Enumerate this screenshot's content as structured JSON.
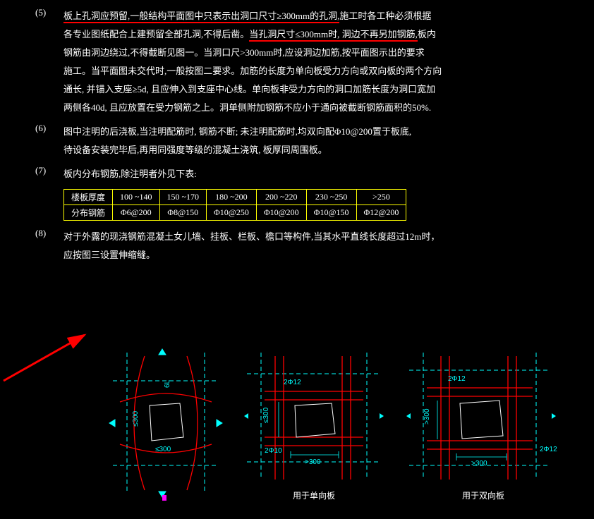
{
  "items": {
    "i5": {
      "num": "(5)",
      "t1a": "板上孔洞应预留,",
      "t1b": "一般结构平面图中只表示出洞口尺寸≥300mm的孔洞,",
      "t1c": "施工时各工种必须根据",
      "t2a": "各专业图纸配合上建预留全部孔洞,不得后凿。",
      "t2b": "当孔洞尺寸≤300mm时, 洞边不再另加钢筋,",
      "t2c": "板内",
      "t3": "钢筋由洞边绕过,不得截断见图一。当洞口尺>300mm时,应设洞边加筋,按平面图示出的要求",
      "t4": "施工。当平面图未交代时,一般按图二要求。加筋的长度为单向板受力方向或双向板的两个方向",
      "t5": "通长, 并锚入支座≥5d, 且应伸入到支座中心线。单向板非受力方向的洞口加筋长度为洞口宽加",
      "t6": "两侧各40d, 且应放置在受力钢筋之上。洞单侧附加钢筋不应小于通向被截断钢筋面积的50%."
    },
    "i6": {
      "num": "(6)",
      "t1": "图中注明的后浇板,当注明配筋时, 钢筋不断; 未注明配筋时,均双向配Φ10@200置于板底,",
      "t2": "待设备安装完毕后,再用同强度等级的混凝土浇筑, 板厚同周围板。"
    },
    "i7": {
      "num": "(7)",
      "t1": "板内分布钢筋,除注明者外见下表:"
    },
    "i8": {
      "num": "(8)",
      "t1": "对于外露的现浇钢筋混凝土女儿墙、挂板、栏板、檐口等构件,当其水平直线长度超过12m时，",
      "t2": "应按图三设置伸缩缝。"
    }
  },
  "table": {
    "header": {
      "h0": "楼板厚度",
      "h1": "100  ~140",
      "h2": "150  ~170",
      "h3": "180  ~200",
      "h4": "200  ~220",
      "h5": "230  ~250",
      "h6": ">250"
    },
    "row": {
      "r0": "分布钢筋",
      "r1": "Φ6@200",
      "r2": "Φ8@150",
      "r3": "Φ10@250",
      "r4": "Φ10@200",
      "r5": "Φ10@150",
      "r6": "Φ12@200"
    }
  },
  "diagrams": {
    "d1": {
      "dim1": "≤300",
      "dim2": "≤300",
      "dim3": "6L"
    },
    "d2": {
      "label": "用于单向板",
      "dim1": "2Φ12",
      "dim2": "2Φ10",
      "dim3": ">300",
      "dim4": "≤300"
    },
    "d3": {
      "label": "用于双向板",
      "dim1": "2Φ12",
      "dim2": "2Φ12",
      "dim3": ">300",
      "dim4": ">300"
    }
  },
  "chart_data": {
    "type": "table",
    "title": "板内分布钢筋",
    "columns": [
      "楼板厚度",
      "分布钢筋"
    ],
    "rows": [
      [
        "100~140",
        "Φ6@200"
      ],
      [
        "150~170",
        "Φ8@150"
      ],
      [
        "180~200",
        "Φ10@250"
      ],
      [
        "200~220",
        "Φ10@200"
      ],
      [
        "230~250",
        "Φ10@150"
      ],
      [
        ">250",
        "Φ12@200"
      ]
    ]
  }
}
